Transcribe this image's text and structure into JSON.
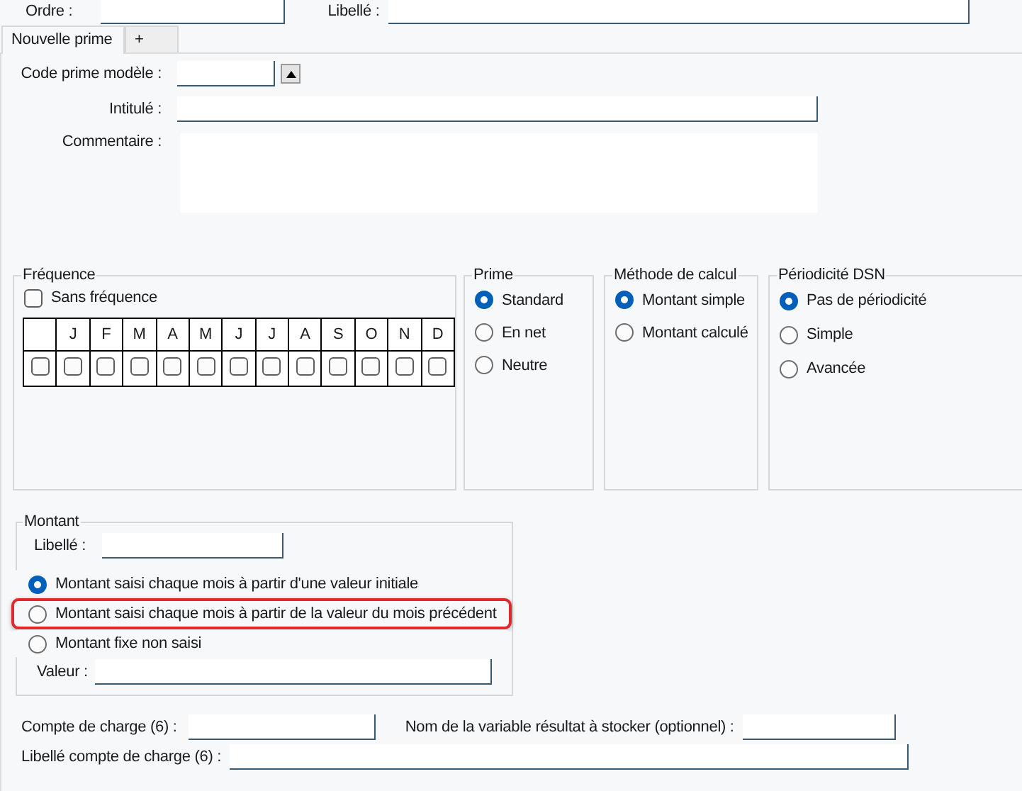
{
  "top_fields": [
    {
      "label": "Ordre :"
    },
    {
      "label": "Libellé :"
    }
  ],
  "tabs": [
    {
      "label": "Nouvelle prime",
      "selected": true
    },
    {
      "label": "+",
      "selected": false
    }
  ],
  "form": {
    "code_label": "Code prime modèle :",
    "intitule_label": "Intitulé :",
    "commentaire_label": "Commentaire :"
  },
  "frequence": {
    "title": "Fréquence",
    "sans_frequence": {
      "label": "Sans fréquence",
      "checked": false
    },
    "row_checkbox": {
      "checked": false
    },
    "months": [
      {
        "label": "J",
        "checked": false
      },
      {
        "label": "F",
        "checked": false
      },
      {
        "label": "M",
        "checked": false
      },
      {
        "label": "A",
        "checked": false
      },
      {
        "label": "M",
        "checked": false
      },
      {
        "label": "J",
        "checked": false
      },
      {
        "label": "J",
        "checked": false
      },
      {
        "label": "A",
        "checked": false
      },
      {
        "label": "S",
        "checked": false
      },
      {
        "label": "O",
        "checked": false
      },
      {
        "label": "N",
        "checked": false
      },
      {
        "label": "D",
        "checked": false
      }
    ]
  },
  "radio_groups": [
    {
      "title": "Prime",
      "options": [
        {
          "label": "Standard",
          "selected": true
        },
        {
          "label": "En net",
          "selected": false
        },
        {
          "label": "Neutre",
          "selected": false
        }
      ]
    },
    {
      "title": "Méthode de calcul",
      "options": [
        {
          "label": "Montant simple",
          "selected": true
        },
        {
          "label": "Montant calculé",
          "selected": false
        }
      ]
    },
    {
      "title": "Périodicité DSN",
      "options": [
        {
          "label": "Pas de périodicité",
          "selected": true
        },
        {
          "label": "Simple",
          "selected": false
        },
        {
          "label": "Avancée",
          "selected": false
        }
      ]
    }
  ],
  "montant": {
    "title": "Montant",
    "libelle_label": "Libellé :",
    "options": [
      {
        "label": "Montant saisi chaque mois à partir d'une valeur initiale",
        "selected": true,
        "highlighted": false
      },
      {
        "label": "Montant saisi chaque mois à partir de la valeur du mois précédent",
        "selected": false,
        "highlighted": true
      },
      {
        "label": "Montant fixe non saisi",
        "selected": false,
        "highlighted": false
      }
    ],
    "valeur_label": "Valeur :"
  },
  "compte_label": "Compte de charge (6) :",
  "variable_label": "Nom de la variable résultat à stocker (optionnel) :",
  "libelle_compte_label": "Libellé compte de charge (6) :"
}
